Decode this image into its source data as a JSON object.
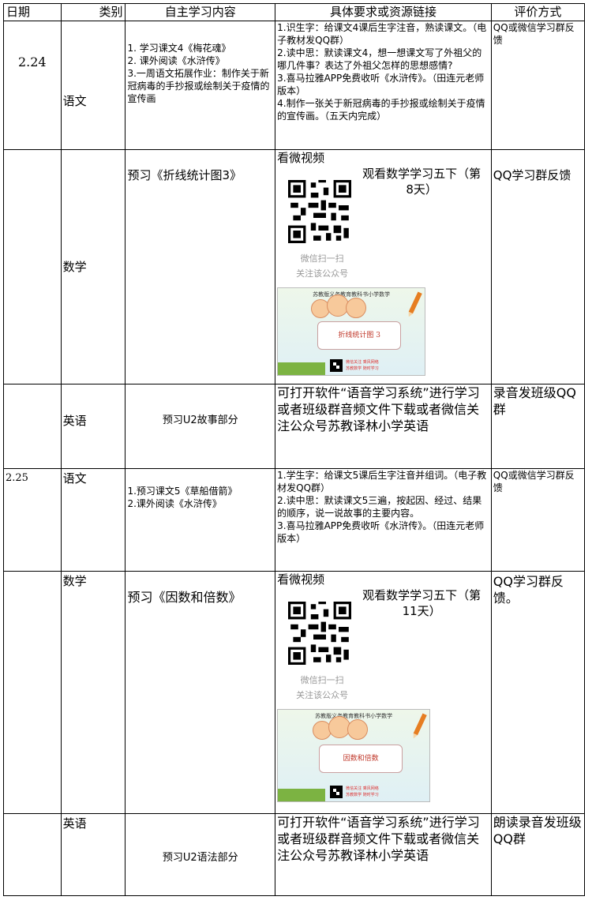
{
  "headers": [
    "日期",
    "类别",
    "自主学习内容",
    "具体要求或资源链接",
    "评价方式"
  ],
  "rows": [
    {
      "date": "2.24",
      "category": "语文",
      "content": [
        "1. 学习课文4《梅花魂》",
        "2. 课外阅读《水浒传》",
        "3.一周语文拓展作业：制作关于新冠病毒的手抄报或绘制关于疫情的宣传画"
      ],
      "requirements": [
        "1.识生字：给课文4课后生字注音，熟读课文。（电子教材发QQ群）",
        "2.读中思：默读课文4，想一想课文写了外祖父的哪几件事？表达了外祖父怎样的思想感情?",
        "3.喜马拉雅APP免费收听《水浒传》。（田连元老师版本）",
        "4.制作一张关于新冠病毒的手抄报或绘制关于疫情的宣传画。（五天内完成）"
      ],
      "evaluation": "QQ或微信学习群反馈"
    },
    {
      "date": "",
      "category": "数学",
      "content": "预习《折线统计图3》",
      "video_label": "看微视频",
      "watch_text": "观看数学学习五下（第8天）",
      "scan_lines": [
        "微信扫一扫",
        "关注该公众号"
      ],
      "cover_header": "苏教版义务教育教科书小学数学",
      "cover_title": "折线统计图 3",
      "cover_note": [
        "微信关注 乘风网络",
        "苏教数学 随时学习"
      ],
      "evaluation": "QQ学习群反馈"
    },
    {
      "date": "",
      "category": "英语",
      "content": "预习U2故事部分",
      "requirements": "可打开软件“语音学习系统”进行学习或者班级群音频文件下载或者微信关注公众号苏教译林小学英语",
      "evaluation": "录音发班级QQ群"
    },
    {
      "date": "2.25",
      "category": "语文",
      "content": [
        "1.预习课文5《草船借箭》",
        "2.课外阅读《水浒传》"
      ],
      "requirements": [
        "1.学生字：给课文5课后生字注音并组词。（电子教材发QQ群）",
        "2.读中思：默读课文5三遍，按起因、经过、结果的顺序，说一说故事的主要内容。",
        "3.喜马拉雅APP免费收听《水浒传》。（田连元老师版本）"
      ],
      "evaluation": "QQ或微信学习群反馈"
    },
    {
      "date": "",
      "category": "数学",
      "content": "预习《因数和倍数》",
      "video_label": "看微视频",
      "watch_text": "观看数学学习五下（第11天）",
      "scan_lines": [
        "微信扫一扫",
        "关注该公众号"
      ],
      "cover_header": "苏教版义务教育教科书小学数学",
      "cover_title": "因数和倍数",
      "cover_note": [
        "微信关注 乘风网络",
        "苏教数学 随时学习"
      ],
      "evaluation": "QQ学习群反馈。"
    },
    {
      "date": "",
      "category": "英语",
      "content": "预习U2语法部分",
      "requirements": "可打开软件“语音学习系统”进行学习或者班级群音频文件下载或者微信关注公众号苏教译林小学英语",
      "evaluation": "朗读录音发班级QQ群"
    }
  ],
  "colors": {
    "scan_text": "#999999",
    "cover_title": "#c0392b"
  }
}
